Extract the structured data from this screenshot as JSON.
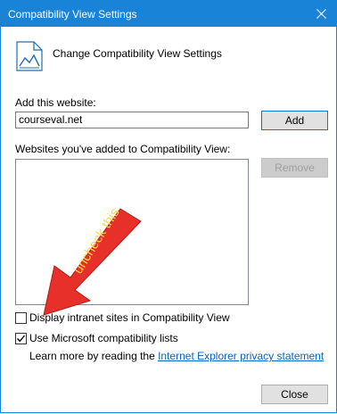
{
  "window": {
    "title": "Compatibility View Settings",
    "header": "Change Compatibility View Settings",
    "title_bar_color": "#1883d7"
  },
  "add_site": {
    "label": "Add this website:",
    "value": "courseval.net",
    "add_button": "Add"
  },
  "sites_list": {
    "label": "Websites you've added to Compatibility View:",
    "items": [],
    "remove_button": "Remove"
  },
  "options": {
    "intranet_label": "Display intranet sites in Compatibility View",
    "intranet_checked": false,
    "ms_lists_label": "Use Microsoft compatibility lists",
    "ms_lists_checked": true
  },
  "learn_more": {
    "prefix": "Learn more by reading the ",
    "link": "Internet Explorer privacy statement"
  },
  "annotation": {
    "text": "uncheck this",
    "arrow_color": "#e8302a",
    "text_color": "#ffd54a"
  },
  "footer": {
    "close_button": "Close"
  },
  "icons": {
    "close": "close-icon",
    "page": "compatibility-page-icon",
    "check": "check-icon"
  }
}
